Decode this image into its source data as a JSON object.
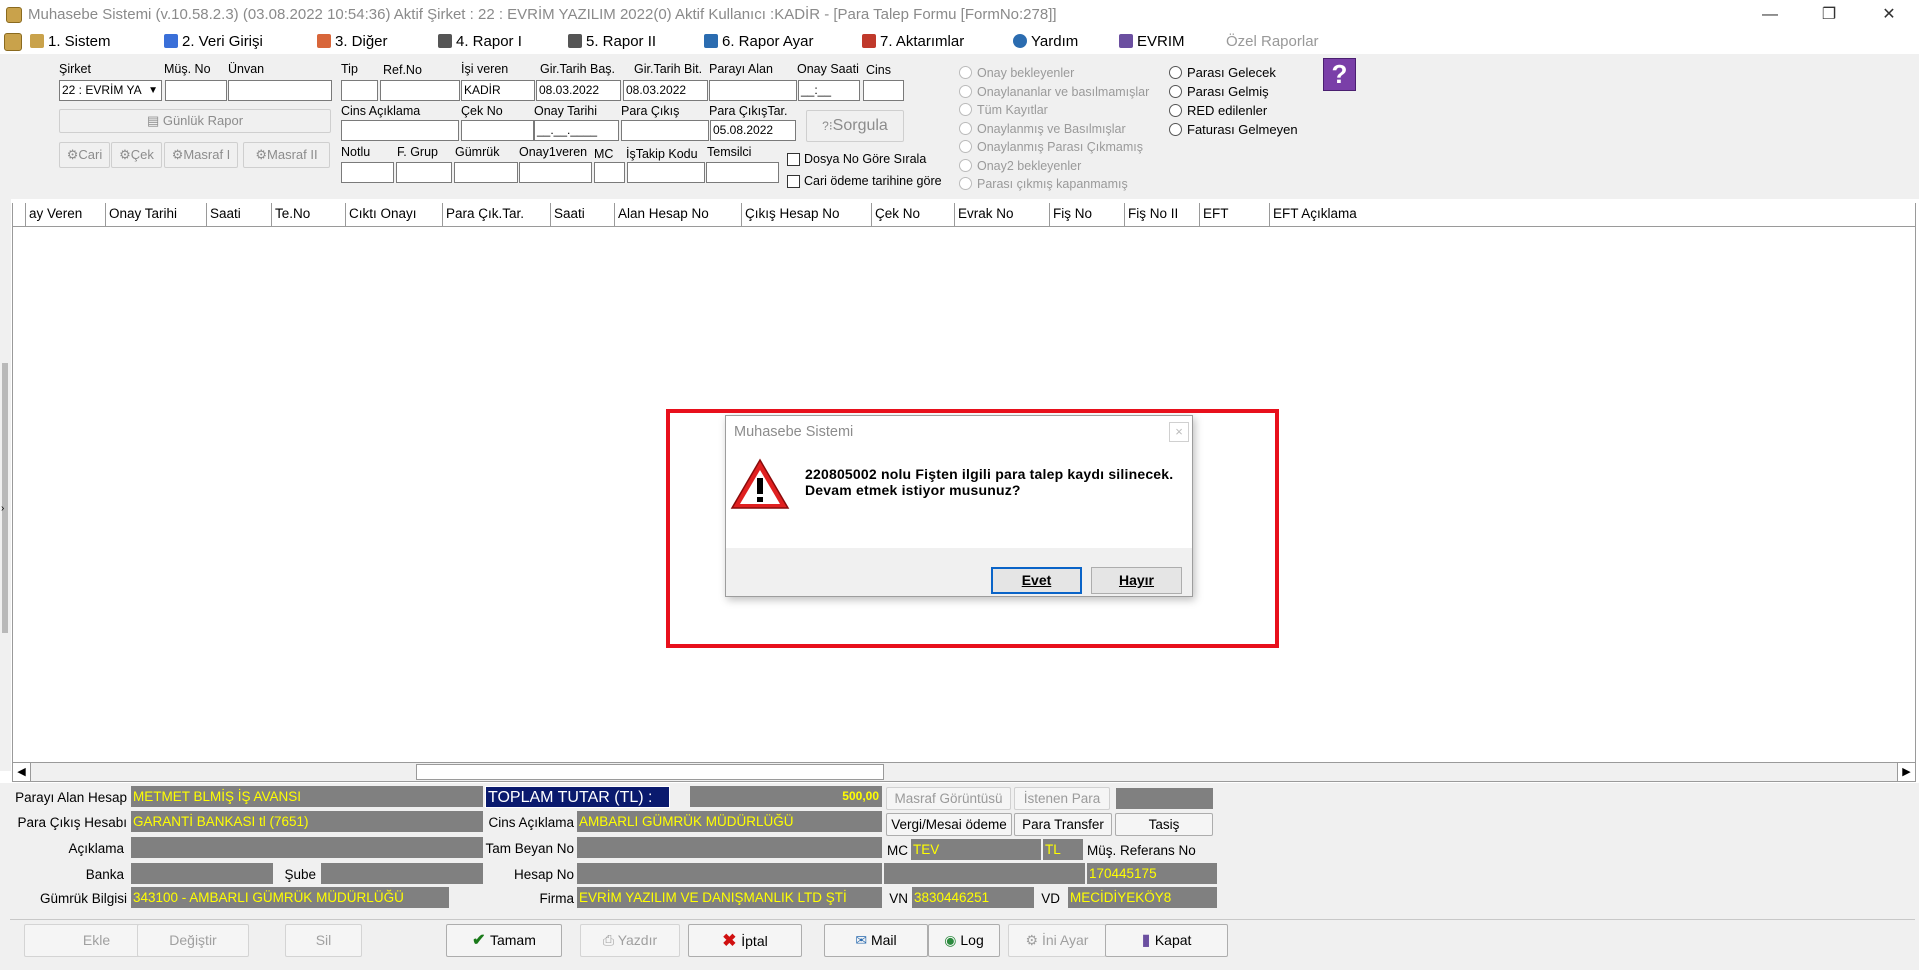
{
  "window": {
    "title": "Muhasebe Sistemi (v.10.58.2.3) (03.08.2022 10:54:36) Aktif Şirket : 22 : EVRİM YAZILIM  2022(0) Aktif Kullanıcı :KADİR - [Para Talep Formu [FormNo:278]]",
    "minimize": "—",
    "restore": "❐",
    "close": "✕"
  },
  "menu": {
    "items": [
      {
        "label": "1.  Sistem",
        "icon": "coins-icon",
        "color": "#c9a24b"
      },
      {
        "label": "2.  Veri Girişi",
        "icon": "edit-form-icon",
        "color": "#3a6fd8"
      },
      {
        "label": "3.  Diğer",
        "icon": "shapes-icon",
        "color": "#d8663a"
      },
      {
        "label": "4.  Rapor I",
        "icon": "printer-icon",
        "color": "#555555"
      },
      {
        "label": "5.  Rapor II",
        "icon": "printer-icon",
        "color": "#555555"
      },
      {
        "label": "6.  Rapor Ayar",
        "icon": "report-settings-icon",
        "color": "#2b6cb0"
      },
      {
        "label": "7.  Aktarımlar",
        "icon": "transfer-icon",
        "color": "#c0392b"
      },
      {
        "label": "Yardım",
        "icon": "help-icon",
        "color": "#2b6cb0"
      },
      {
        "label": "EVRIM",
        "icon": "book-icon",
        "color": "#6b4fa0"
      },
      {
        "label": "Özel Raporlar",
        "icon": "",
        "color": "#999999"
      }
    ],
    "mdi_min": "–",
    "mdi_restore": "▫",
    "mdi_close": "×"
  },
  "filters": {
    "sirket_label": "Şirket",
    "sirket_value": "22 : EVRİM YA",
    "mus_no_label": "Müş. No",
    "unvan_label": "Ünvan",
    "gunluk_rapor": "Günlük Rapor",
    "cari": "Cari",
    "cek": "Çek",
    "masraf1": "Masraf I",
    "masraf2": "Masraf II",
    "tip_label": "Tip",
    "refno_label": "Ref.No",
    "isiveren_label": "İşi veren",
    "isiveren_value": "KADİR",
    "girbas_label": "Gir.Tarih Baş.",
    "girbas_value": "08.03.2022",
    "girbit_label": "Gir.Tarih Bit.",
    "girbit_value": "08.03.2022",
    "parayialan_label": "Parayı Alan",
    "onaysaati_label": "Onay Saati",
    "onaysaati_value": "__:__",
    "cins_label": "Cins",
    "cinsaciklama_label": "Cins Açıklama",
    "cekno_label": "Çek No",
    "onaytarihi_label": "Onay Tarihi",
    "onaytarihi_value": "__.__.____",
    "paracikis_label": "Para Çıkış",
    "paracikistar_label": "Para ÇıkışTar.",
    "paracikistar_value": "05.08.2022",
    "sorgula": "Sorgula",
    "sorgula_prefix": "?⁝",
    "notlu_label": "Notlu",
    "fgrup_label": "F. Grup",
    "gumruk_label": "Gümrük",
    "onay1veren_label": "Onay1veren",
    "mc_label": "MC",
    "istakip_label": "İşTakip Kodu",
    "temsilci_label": "Temsilci",
    "dosyano_label": "Dosya No Göre Sırala",
    "cariodeme_label": "Cari ödeme tarihine göre",
    "radios_left": [
      "Onay bekleyenler",
      "Onaylananlar ve basılmamışlar",
      "Tüm Kayıtlar",
      "Onaylanmış ve Basılmışlar",
      "Onaylanmış Parası Çıkmamış",
      "Onay2 bekleyenler",
      "Parası çıkmış kapanmamış"
    ],
    "radios_right": [
      "Parası Gelecek",
      "Parası Gelmiş",
      "RED edilenler",
      "Faturası Gelmeyen"
    ],
    "help_glyph": "?"
  },
  "grid": {
    "columns": [
      "ay Veren",
      "Onay Tarihi",
      "Saati",
      "Te.No",
      "Cıktı Onayı",
      "Para Çık.Tar.",
      "Saati",
      "Alan Hesap No",
      "Çıkış Hesap No",
      "Çek No",
      "Evrak No",
      "Fiş No",
      "Fiş No II",
      "EFT",
      "EFT Açıklama"
    ]
  },
  "bottom": {
    "parayi_alan_hesap_label": "Parayı Alan Hesap",
    "parayi_alan_hesap_value": "METMET BLMİŞ İŞ AVANSI",
    "para_cikis_hesabi_label": "Para Çıkış Hesabı",
    "para_cikis_hesabi_value": "GARANTİ BANKASI tl (7651)",
    "aciklama_label": "Açıklama",
    "banka_label": "Banka",
    "sube_label": "Şube",
    "gumruk_bilgisi_label": "Gümrük Bilgisi",
    "gumruk_bilgisi_value": "343100 - AMBARLI  GÜMRÜK MÜDÜRLÜĞÜ",
    "toplam_label": "TOPLAM TUTAR (TL) :",
    "toplam_value": "500,00",
    "cins_aciklama_label": "Cins Açıklama",
    "cins_aciklama_value": "AMBARLI  GÜMRÜK MÜDÜRLÜĞÜ",
    "tam_beyan_label": "Tam Beyan No",
    "hesap_no_label": "Hesap No",
    "firma_label": "Firma",
    "firma_value": "EVRİM YAZILIM VE DANIŞMANLIK LTD ŞTİ",
    "vn_label": "VN",
    "vn_value": "3830446251",
    "vd_label": "VD",
    "vd_value": "MECİDİYEKÖY8",
    "masraf_goruntusu": "Masraf Görüntüsü",
    "istenen_para": "İstenen Para",
    "vergi_mesai": "Vergi/Mesai ödeme",
    "para_transfer": "Para Transfer",
    "tasis": "Tasiş",
    "mc_label": "MC",
    "mc_value": "TEV",
    "tl_value": "TL",
    "mus_ref_label": "Müş. Referans No",
    "mus_ref_value": "170445175"
  },
  "toolbar": {
    "ekle": "Ekle",
    "degistir": "Değiştir",
    "sil": "Sil",
    "tamam": "Tamam",
    "yazdir": "Yazdır",
    "iptal": "İptal",
    "mail": "Mail",
    "log": "Log",
    "ini_ayar": "İni Ayar",
    "kapat": "Kapat"
  },
  "dialog": {
    "title": "Muhasebe Sistemi",
    "close": "×",
    "line1": "220805002 nolu Fişten ilgili para talep kaydı silinecek.",
    "line2": "Devam etmek istiyor musunuz?",
    "yes": "Evet",
    "no": "Hayır",
    "highlight_color": "#e8101c"
  }
}
